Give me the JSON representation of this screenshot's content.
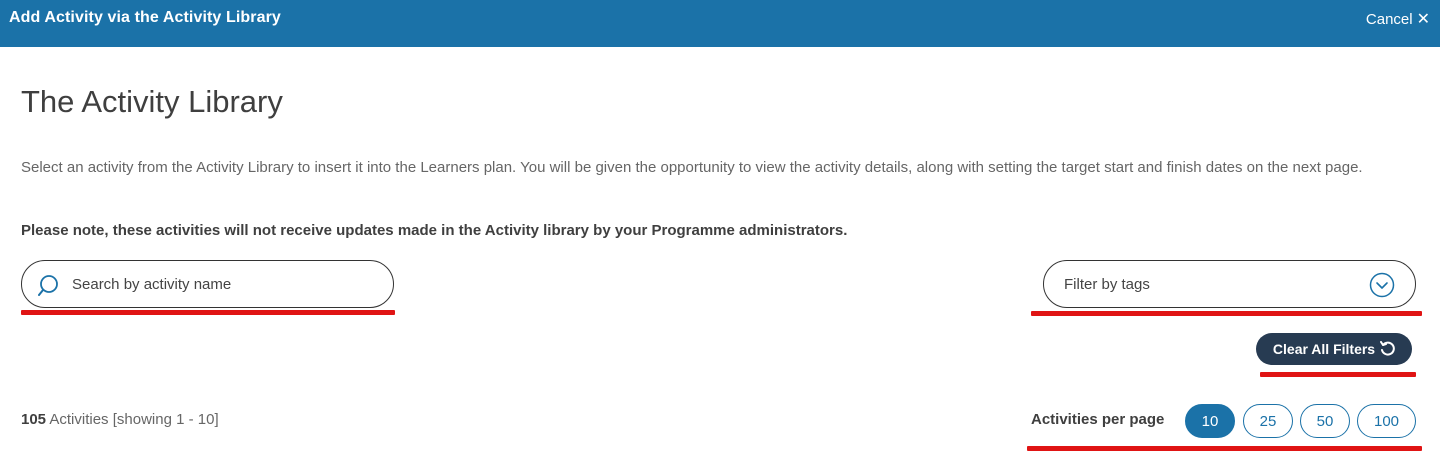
{
  "header": {
    "title": "Add Activity via the Activity Library",
    "cancel_label": "Cancel",
    "cancel_icon": "close-icon"
  },
  "main": {
    "title": "The Activity Library",
    "intro": "Select an activity from the Activity Library to insert it into the Learners plan. You will be given the opportunity to view the activity details, along with setting the target start and finish dates on the next page.",
    "note": "Please note, these activities will not receive updates made in the Activity library by your Programme administrators."
  },
  "search": {
    "placeholder": "Search by activity name",
    "value": "",
    "icon": "search-icon"
  },
  "filter": {
    "label": "Filter by tags",
    "icon": "chevron-down-circle-icon"
  },
  "clear_filters": {
    "label": "Clear All Filters",
    "icon": "reset-icon"
  },
  "results": {
    "count": "105",
    "count_suffix": "Activities [showing 1 - 10]"
  },
  "per_page": {
    "label": "Activities per page",
    "options": [
      "10",
      "25",
      "50",
      "100"
    ],
    "selected": "10"
  },
  "colors": {
    "primary": "#1b72a8",
    "dark_button": "#273b52",
    "annotation_red": "#e01414"
  }
}
